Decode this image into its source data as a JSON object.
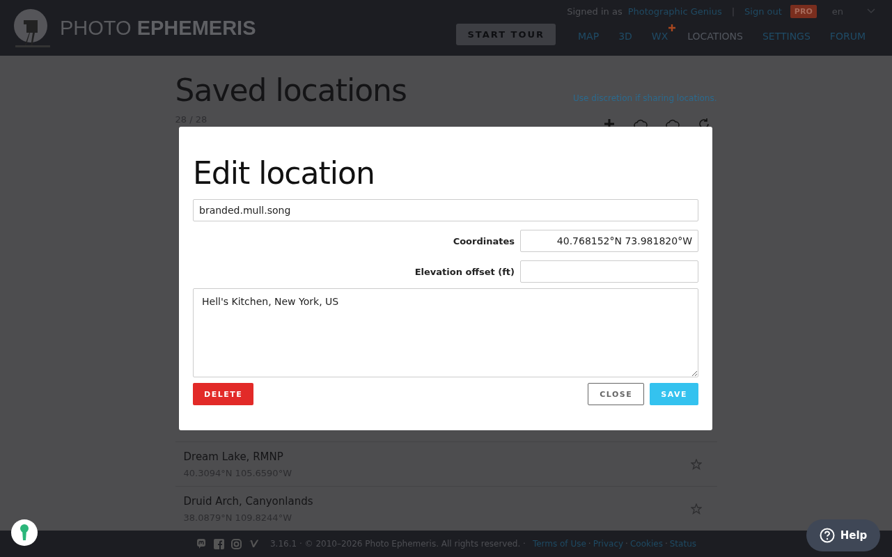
{
  "header": {
    "logo": "PHOTO **EPHEMERIS**",
    "signed_in_label": "Signed in as",
    "user_name": "Photographic Genius",
    "separator": "|",
    "sign_out": "Sign out",
    "badge": "PRO",
    "language": "en",
    "start_tour": "START TOUR",
    "nav": [
      {
        "label": "MAP",
        "selected": false,
        "new": false
      },
      {
        "label": "3D",
        "selected": false,
        "new": false
      },
      {
        "label": "WX",
        "selected": false,
        "new": true
      },
      {
        "label": "LOCATIONS",
        "selected": true,
        "new": false
      },
      {
        "label": "SETTINGS",
        "selected": false,
        "new": false
      },
      {
        "label": "FORUM",
        "selected": false,
        "new": false
      }
    ]
  },
  "page": {
    "title": "Saved locations",
    "note": "Use discretion if sharing locations.",
    "count": "28 / 28",
    "locations": [
      {
        "name": "Dream Lake, RMNP",
        "coords": "40.3094°N 105.6590°W"
      },
      {
        "name": "Druid Arch, Canyonlands",
        "coords": "38.0879°N 109.8244°W"
      }
    ]
  },
  "dialog": {
    "title": "Edit location",
    "name": "branded.mull.song",
    "fields": [
      {
        "label": "Coordinates",
        "value": "40.768152°N 73.981820°W"
      },
      {
        "label": "Elevation offset (ft)"
      }
    ],
    "notes": "Hell's Kitchen, New York, US",
    "delete": "DELETE",
    "close": "CLOSE",
    "save": "SAVE"
  },
  "footer": {
    "version": "3.16.1 · © 2010–2026 Photo Ephemeris. All rights reserved. ·",
    "links": [
      "Terms of Use",
      "Privacy",
      "Cookies",
      "Status"
    ],
    "link_separator": "·"
  },
  "help": "Help"
}
